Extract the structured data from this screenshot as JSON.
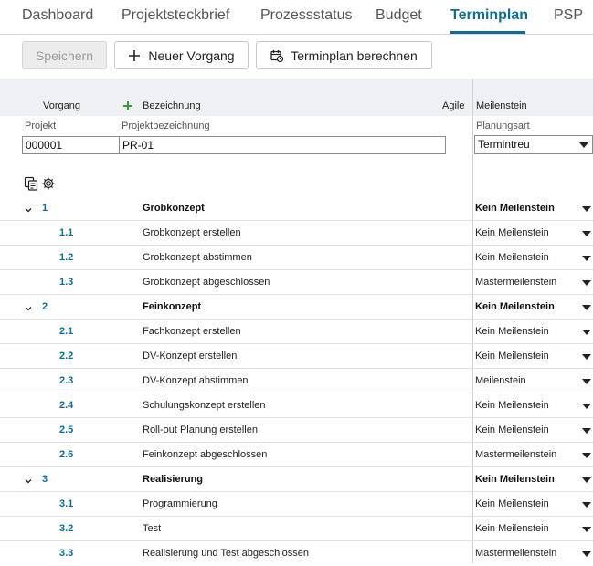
{
  "tabs": [
    {
      "label": "Dashboard",
      "active": false
    },
    {
      "label": "Projektsteckbrief",
      "active": false
    },
    {
      "label": "Prozessstatus",
      "active": false
    },
    {
      "label": "Budget",
      "active": false
    },
    {
      "label": "Terminplan",
      "active": true
    },
    {
      "label": "PSP",
      "active": false
    }
  ],
  "toolbar": {
    "save_label": "Speichern",
    "new_task_label": "Neuer Vorgang",
    "calc_label": "Terminplan berechnen"
  },
  "columns": {
    "vorgang": "Vorgang",
    "bezeichnung": "Bezeichnung",
    "agile": "Agile",
    "meilenstein": "Meilenstein"
  },
  "project": {
    "projekt_label": "Projekt",
    "projekt_value": "000001",
    "bezeichnung_label": "Projektbezeichnung",
    "bezeichnung_value": "PR-01",
    "planungsart_label": "Planungsart",
    "planungsart_value": "Termintreu"
  },
  "colors": {
    "accent": "#0b6e99",
    "add_green": "#2e9e3e"
  },
  "rows": [
    {
      "num": "1",
      "name": "Grobkonzept",
      "milestone": "Kein Meilenstein",
      "level": 1
    },
    {
      "num": "1.1",
      "name": "Grobkonzept erstellen",
      "milestone": "Kein Meilenstein",
      "level": 2
    },
    {
      "num": "1.2",
      "name": "Grobkonzept abstimmen",
      "milestone": "Kein Meilenstein",
      "level": 2
    },
    {
      "num": "1.3",
      "name": "Grobkonzept abgeschlossen",
      "milestone": "Mastermeilenstein",
      "level": 2
    },
    {
      "num": "2",
      "name": "Feinkonzept",
      "milestone": "Kein Meilenstein",
      "level": 1
    },
    {
      "num": "2.1",
      "name": "Fachkonzept erstellen",
      "milestone": "Kein Meilenstein",
      "level": 2
    },
    {
      "num": "2.2",
      "name": "DV-Konzept erstellen",
      "milestone": "Kein Meilenstein",
      "level": 2
    },
    {
      "num": "2.3",
      "name": "DV-Konzept abstimmen",
      "milestone": "Meilenstein",
      "level": 2
    },
    {
      "num": "2.4",
      "name": "Schulungskonzept erstellen",
      "milestone": "Kein Meilenstein",
      "level": 2
    },
    {
      "num": "2.5",
      "name": "Roll-out Planung erstellen",
      "milestone": "Kein Meilenstein",
      "level": 2
    },
    {
      "num": "2.6",
      "name": "Feinkonzept abgeschlossen",
      "milestone": "Mastermeilenstein",
      "level": 2
    },
    {
      "num": "3",
      "name": "Realisierung",
      "milestone": "Kein Meilenstein",
      "level": 1
    },
    {
      "num": "3.1",
      "name": "Programmierung",
      "milestone": "Kein Meilenstein",
      "level": 2
    },
    {
      "num": "3.2",
      "name": "Test",
      "milestone": "Kein Meilenstein",
      "level": 2
    },
    {
      "num": "3.3",
      "name": "Realisierung und Test abgeschlossen",
      "milestone": "Mastermeilenstein",
      "level": 2
    }
  ]
}
